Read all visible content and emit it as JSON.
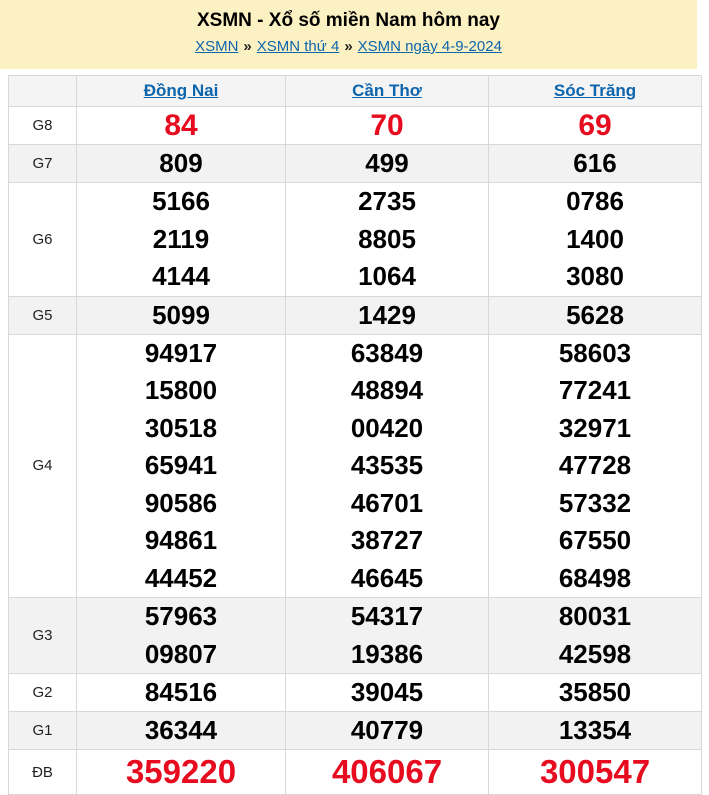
{
  "page": {
    "title": "XSMN - Xổ số miền Nam hôm nay",
    "breadcrumb": {
      "separator": "»",
      "items": [
        "XSMN",
        "XSMN thứ 4",
        "XSMN ngày 4-9-2024"
      ]
    }
  },
  "results_table": {
    "columns": [
      "Đồng Nai",
      "Cần Thơ",
      "Sóc Trăng"
    ],
    "rows": [
      {
        "prize": "G8",
        "cells": [
          [
            "84"
          ],
          [
            "70"
          ],
          [
            "69"
          ]
        ]
      },
      {
        "prize": "G7",
        "cells": [
          [
            "809"
          ],
          [
            "499"
          ],
          [
            "616"
          ]
        ]
      },
      {
        "prize": "G6",
        "cells": [
          [
            "5166",
            "2119",
            "4144"
          ],
          [
            "2735",
            "8805",
            "1064"
          ],
          [
            "0786",
            "1400",
            "3080"
          ]
        ]
      },
      {
        "prize": "G5",
        "cells": [
          [
            "5099"
          ],
          [
            "1429"
          ],
          [
            "5628"
          ]
        ]
      },
      {
        "prize": "G4",
        "cells": [
          [
            "94917",
            "15800",
            "30518",
            "65941",
            "90586",
            "94861",
            "44452"
          ],
          [
            "63849",
            "48894",
            "00420",
            "43535",
            "46701",
            "38727",
            "46645"
          ],
          [
            "58603",
            "77241",
            "32971",
            "47728",
            "57332",
            "67550",
            "68498"
          ]
        ]
      },
      {
        "prize": "G3",
        "cells": [
          [
            "57963",
            "09807"
          ],
          [
            "54317",
            "19386"
          ],
          [
            "80031",
            "42598"
          ]
        ]
      },
      {
        "prize": "G2",
        "cells": [
          [
            "84516"
          ],
          [
            "39045"
          ],
          [
            "35850"
          ]
        ]
      },
      {
        "prize": "G1",
        "cells": [
          [
            "36344"
          ],
          [
            "40779"
          ],
          [
            "13354"
          ]
        ]
      },
      {
        "prize": "ĐB",
        "cells": [
          [
            "359220"
          ],
          [
            "406067"
          ],
          [
            "300547"
          ]
        ]
      }
    ]
  },
  "colors": {
    "accent_red": "#e60b1e",
    "link_blue": "#0d65ad",
    "header_yellow": "#fcf1c2",
    "row_alt_gray": "#f2f2f2"
  }
}
